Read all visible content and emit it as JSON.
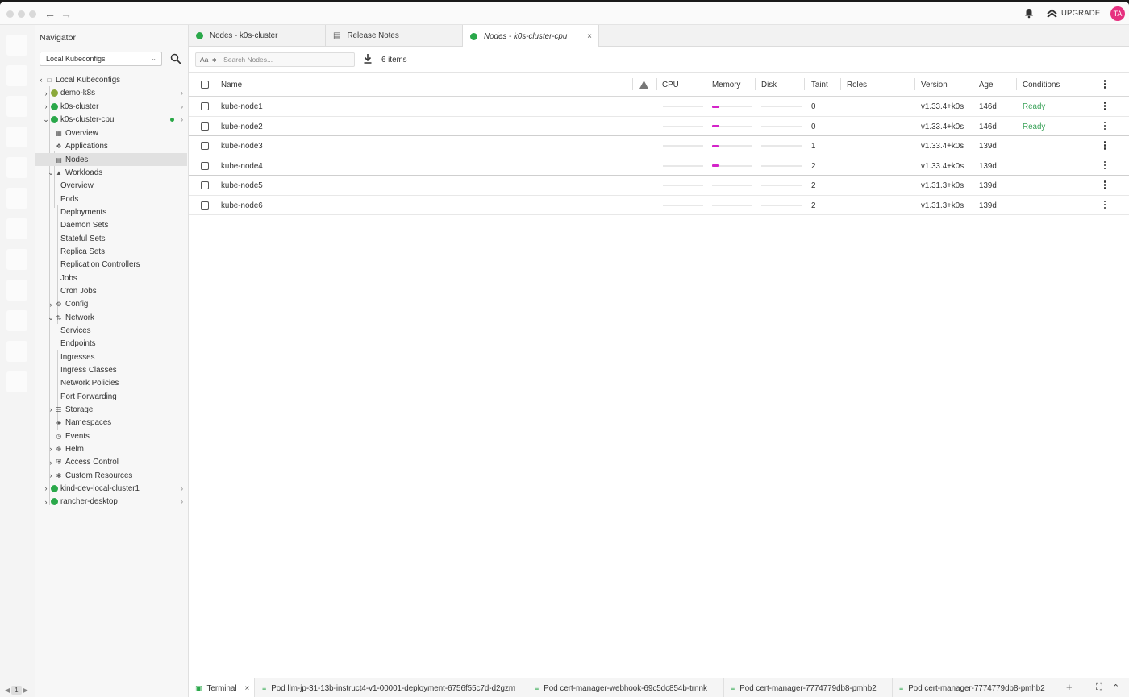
{
  "titlebar": {
    "upgrade_label": "UPGRADE",
    "avatar_initials": "TA"
  },
  "sidebar": {
    "title": "Navigator",
    "kubeconfig_select": "Local Kubeconfigs",
    "tree": {
      "root": "Local Kubeconfigs",
      "clusters": [
        "demo-k8s",
        "k0s-cluster",
        "k0s-cluster-cpu"
      ],
      "overview": "Overview",
      "applications": "Applications",
      "nodes": "Nodes",
      "workloads": "Workloads",
      "workloads_items": [
        "Overview",
        "Pods",
        "Deployments",
        "Daemon Sets",
        "Stateful Sets",
        "Replica Sets",
        "Replication Controllers",
        "Jobs",
        "Cron Jobs"
      ],
      "config": "Config",
      "network": "Network",
      "network_items": [
        "Services",
        "Endpoints",
        "Ingresses",
        "Ingress Classes",
        "Network Policies",
        "Port Forwarding"
      ],
      "storage": "Storage",
      "namespaces": "Namespaces",
      "events": "Events",
      "helm": "Helm",
      "access_control": "Access Control",
      "custom_resources": "Custom Resources",
      "other_clusters": [
        "kind-dev-local-cluster1",
        "rancher-desktop"
      ]
    }
  },
  "rail": {
    "page": "1"
  },
  "tabs": [
    {
      "label": "Nodes - k0s-cluster"
    },
    {
      "label": "Release Notes"
    },
    {
      "label": "Nodes - k0s-cluster-cpu"
    }
  ],
  "toolbar": {
    "case_toggle": "Aa",
    "search_placeholder": "Search Nodes...",
    "item_count": "6 items"
  },
  "table": {
    "headers": {
      "name": "Name",
      "cpu": "CPU",
      "memory": "Memory",
      "disk": "Disk",
      "taints": "Taint",
      "roles": "Roles",
      "version": "Version",
      "age": "Age",
      "conditions": "Conditions"
    },
    "rows": [
      {
        "name": "kube-node1",
        "memory_usage": 0.18,
        "taints": "0",
        "version": "v1.33.4+k0s",
        "age": "146d",
        "conditions": "Ready"
      },
      {
        "name": "kube-node2",
        "memory_usage": 0.18,
        "taints": "0",
        "version": "v1.33.4+k0s",
        "age": "146d",
        "conditions": "Ready"
      },
      {
        "name": "kube-node3",
        "memory_usage": 0.15,
        "taints": "1",
        "version": "v1.33.4+k0s",
        "age": "139d",
        "conditions": ""
      },
      {
        "name": "kube-node4",
        "memory_usage": 0.15,
        "taints": "2",
        "version": "v1.33.4+k0s",
        "age": "139d",
        "conditions": ""
      },
      {
        "name": "kube-node5",
        "memory_usage": 0,
        "taints": "2",
        "version": "v1.31.3+k0s",
        "age": "139d",
        "conditions": ""
      },
      {
        "name": "kube-node6",
        "memory_usage": 0,
        "taints": "2",
        "version": "v1.31.3+k0s",
        "age": "139d",
        "conditions": ""
      }
    ]
  },
  "dock": {
    "tabs": [
      {
        "label": "Terminal"
      },
      {
        "label": "Pod llm-jp-31-13b-instruct4-v1-00001-deployment-6756f55c7d-d2gzm"
      },
      {
        "label": "Pod cert-manager-webhook-69c5dc854b-trnnk"
      },
      {
        "label": "Pod cert-manager-7774779db8-pmhb2"
      },
      {
        "label": "Pod cert-manager-7774779db8-pmhb2"
      }
    ]
  },
  "colors": {
    "accent": "#d423c9",
    "ready": "#3ba35a",
    "avatar": "#e6307f",
    "k8s_green": "#2aa84a"
  }
}
